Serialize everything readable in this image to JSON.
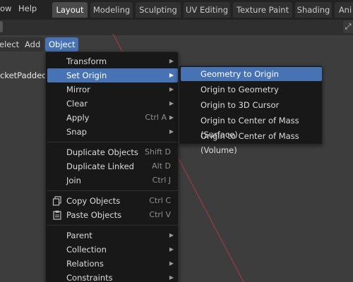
{
  "topbar": {
    "menus": [
      "ow",
      "Help"
    ],
    "workspaces": [
      {
        "label": "Layout",
        "active": true
      },
      {
        "label": "Modeling",
        "active": false
      },
      {
        "label": "Sculpting",
        "active": false
      },
      {
        "label": "UV Editing",
        "active": false
      },
      {
        "label": "Texture Paint",
        "active": false
      },
      {
        "label": "Shading",
        "active": false
      },
      {
        "label": "Ani",
        "active": false
      }
    ]
  },
  "viewport": {
    "menus": [
      "elect",
      "Add",
      "Object"
    ],
    "object_name": "cketPaddedD("
  },
  "object_menu": {
    "items": [
      {
        "label": "Transform",
        "shortcut": "",
        "submenu": true
      },
      {
        "label": "Set Origin",
        "shortcut": "",
        "submenu": true,
        "highlighted": true
      },
      {
        "label": "Mirror",
        "shortcut": "",
        "submenu": true
      },
      {
        "label": "Clear",
        "shortcut": "",
        "submenu": true
      },
      {
        "label": "Apply",
        "shortcut": "Ctrl A",
        "submenu": true
      },
      {
        "label": "Snap",
        "shortcut": "",
        "submenu": true
      },
      {
        "label": "Duplicate Objects",
        "shortcut": "Shift D"
      },
      {
        "label": "Duplicate Linked",
        "shortcut": "Alt D"
      },
      {
        "label": "Join",
        "shortcut": "Ctrl J"
      },
      {
        "label": "Copy Objects",
        "shortcut": "Ctrl C",
        "icon": "copy-icon"
      },
      {
        "label": "Paste Objects",
        "shortcut": "Ctrl V",
        "icon": "paste-icon"
      },
      {
        "label": "Parent",
        "shortcut": "",
        "submenu": true
      },
      {
        "label": "Collection",
        "shortcut": "",
        "submenu": true
      },
      {
        "label": "Relations",
        "shortcut": "",
        "submenu": true
      },
      {
        "label": "Constraints",
        "shortcut": "",
        "submenu": true
      }
    ]
  },
  "set_origin_submenu": {
    "items": [
      {
        "label": "Geometry to Origin",
        "highlighted": true
      },
      {
        "label": "Origin to Geometry"
      },
      {
        "label": "Origin to 3D Cursor"
      },
      {
        "label": "Origin to Center of Mass (Surface)"
      },
      {
        "label": "Origin to Center of Mass (Volume)"
      }
    ]
  },
  "colors": {
    "accent": "#4772b3",
    "menu_bg": "#181818",
    "viewport_bg": "#3d3d3d",
    "axis_red": "#8b3a44"
  }
}
